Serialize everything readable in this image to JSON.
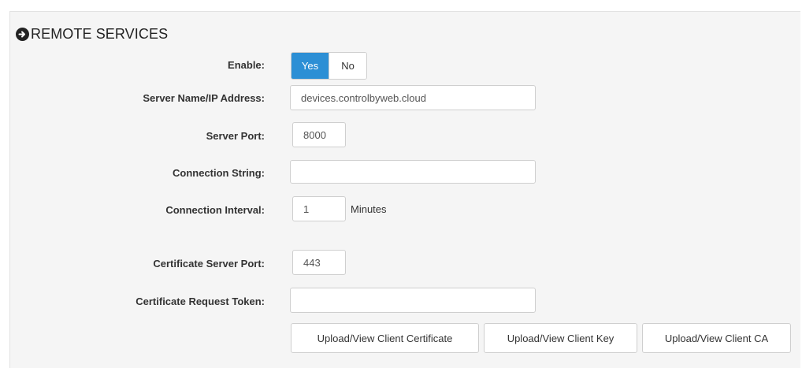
{
  "section": {
    "title": "REMOTE SERVICES",
    "icon": "arrow-right-circle-icon"
  },
  "enable": {
    "label": "Enable:",
    "yes_label": "Yes",
    "no_label": "No",
    "selected": "Yes",
    "accent_color": "#2c8fd5"
  },
  "server_name": {
    "label": "Server Name/IP Address:",
    "value": "devices.controlbyweb.cloud"
  },
  "server_port": {
    "label": "Server Port:",
    "value": "8000"
  },
  "connection_string": {
    "label": "Connection String:",
    "value": ""
  },
  "connection_interval": {
    "label": "Connection Interval:",
    "value": "1",
    "unit": "Minutes"
  },
  "cert_server_port": {
    "label": "Certificate Server Port:",
    "value": "443"
  },
  "cert_request_token": {
    "label": "Certificate Request Token:",
    "value": ""
  },
  "buttons": {
    "client_certificate": "Upload/View Client Certificate",
    "client_key": "Upload/View Client Key",
    "client_ca": "Upload/View Client CA"
  }
}
